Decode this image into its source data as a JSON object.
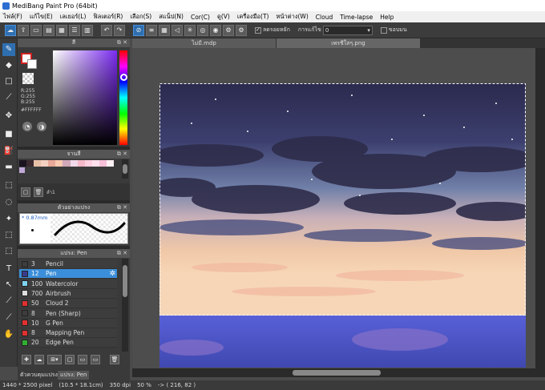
{
  "window": {
    "title": "MediBang Paint Pro (64bit)"
  },
  "menu": [
    "ไฟล์(F)",
    "แก้ไข(E)",
    "เลเยอร์(L)",
    "ฟิลเตอร์(R)",
    "เลือก(S)",
    "สแน็ป(N)",
    "Cor(C)",
    "ดู(V)",
    "เครื่องมือ(T)",
    "หน้าต่าง(W)",
    "Cloud",
    "Time-lapse",
    "Help"
  ],
  "toolbar": {
    "antialias_label": "ลดรอยหยัก",
    "correction_label": "การแก้ไข",
    "correction_value": "0",
    "auto_label": "ขอบมน"
  },
  "tabs": [
    {
      "label": "ไม่มี.mdp",
      "active": false
    },
    {
      "label": "เพรชีใสๆ.png",
      "active": true
    }
  ],
  "color_panel": {
    "title": "สี",
    "rgb": "R:255\nG:255\nB:255",
    "hex": "#FFFFFF",
    "primary_color": "#ffffff",
    "secondary_color": "#ffffff"
  },
  "palette_panel": {
    "title": "จานสี",
    "index_label": "ลำ1"
  },
  "brush_preview_panel": {
    "title": "ตัวอย่างแปรง",
    "size": "0.87mm"
  },
  "brush_panel": {
    "title": "แปรง: Pen",
    "items": [
      {
        "size": "3",
        "name": "Pencil",
        "color": "#3d3d3d",
        "selected": false
      },
      {
        "size": "12",
        "name": "Pen",
        "color": "#3b3b8a",
        "selected": true
      },
      {
        "size": "100",
        "name": "Watercolor",
        "color": "#7fd3f0",
        "selected": false
      },
      {
        "size": "700",
        "name": "Airbrush",
        "color": "#dddddd",
        "selected": false
      },
      {
        "size": "50",
        "name": "Cloud 2",
        "color": "#e03030",
        "selected": false
      },
      {
        "size": "8",
        "name": "Pen (Sharp)",
        "color": "#3d3d3d",
        "selected": false
      },
      {
        "size": "10",
        "name": "G Pen",
        "color": "#e03030",
        "selected": false
      },
      {
        "size": "8",
        "name": "Mapping Pen",
        "color": "#e03030",
        "selected": false
      },
      {
        "size": "20",
        "name": "Edge Pen",
        "color": "#30b030",
        "selected": false
      }
    ]
  },
  "panel_tabs": [
    {
      "label": "ตัวควบคุมแปรง",
      "active": false
    },
    {
      "label": "แปรง: Pen",
      "active": true
    }
  ],
  "status": {
    "size": "1440 * 2500 pixel",
    "cm": "(10.5 * 18.1cm)",
    "dpi": "350 dpi",
    "zoom": "50 %",
    "coords": "-> ( 216, 82 )"
  }
}
